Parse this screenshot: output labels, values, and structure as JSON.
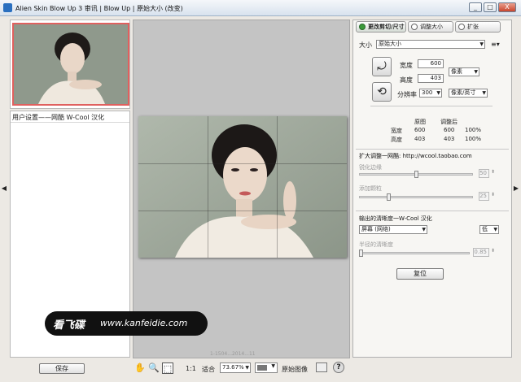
{
  "window": {
    "title": "Alien Skin Blow Up 3 审讯 | Blow Up | 原始大小 (改变)",
    "buttons": [
      "_",
      "□",
      "X"
    ]
  },
  "left_panel": {
    "preset_item": "用户设置——网酷 W-Cool 汉化",
    "save_label": "保存"
  },
  "watermark": {
    "brand": "看飞碟",
    "url": "www.kanfeidie.com",
    "sub": "1-1504...2014...11"
  },
  "toolbar": {
    "one_to_one": "1:1",
    "fit": "适合",
    "zoom_value": "73.67%",
    "original_image": "原始图像",
    "help": "?"
  },
  "right_panel": {
    "tabs": [
      {
        "label": "更改剪切/尺寸",
        "active": true
      },
      {
        "label": "调整大小",
        "active": false
      },
      {
        "label": "扩张",
        "active": false
      }
    ],
    "size_label": "大小",
    "size_value": "原始大小",
    "width_label": "宽度",
    "width_value": "600",
    "height_label": "高度",
    "height_value": "403",
    "unit_value": "像素",
    "resolution_label": "分辨率",
    "resolution_value": "300",
    "res_unit_value": "像素/英寸",
    "table": {
      "col_original": "原图",
      "col_adjusted": "调整后",
      "rows": [
        {
          "label": "宽度",
          "original": "600",
          "adjusted": "600",
          "pct": "100%"
        },
        {
          "label": "高度",
          "original": "403",
          "adjusted": "403",
          "pct": "100%"
        }
      ]
    },
    "enlarge_title": "扩大调整一网酷: http://wcool.taobao.com",
    "sharpen_label": "锐化边缘",
    "sharpen_value": "50",
    "sharpen_level": 0.5,
    "grain_label": "添加颗粒",
    "grain_value": "25",
    "grain_level": 0.25,
    "output_title": "输出的清晰度一W-Cool 汉化",
    "screen_value": "屏幕 (网络)",
    "low_value": "低",
    "radius_label": "半径的清晰度",
    "radius_value": "0.85",
    "radius_level": 0.0,
    "reset_label": "复位"
  }
}
